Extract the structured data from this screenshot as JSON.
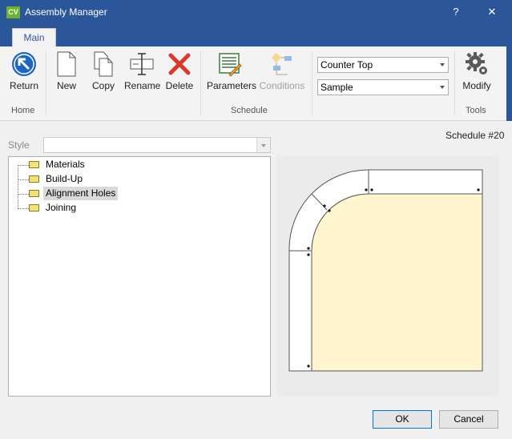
{
  "window": {
    "app_badge": "CV",
    "title": "Assembly Manager",
    "help": "?",
    "close": "✕"
  },
  "tabs": [
    {
      "label": "Main",
      "active": true
    }
  ],
  "ribbon": {
    "home": {
      "return_label": "Return",
      "group_label": "Home"
    },
    "schedule": {
      "new_label": "New",
      "copy_label": "Copy",
      "rename_label": "Rename",
      "delete_label": "Delete",
      "parameters_label": "Parameters",
      "conditions_label": "Conditions",
      "group_label": "Schedule",
      "combo_top": "Counter Top",
      "combo_bottom": "Sample"
    },
    "tools": {
      "modify_label": "Modify",
      "group_label": "Tools"
    }
  },
  "style": {
    "label": "Style",
    "value": ""
  },
  "schedule_number": "Schedule #20",
  "tree": {
    "items": [
      {
        "label": "Materials"
      },
      {
        "label": "Build-Up"
      },
      {
        "label": "Alignment Holes",
        "selected": true
      },
      {
        "label": "Joining"
      }
    ]
  },
  "buttons": {
    "ok": "OK",
    "cancel": "Cancel"
  },
  "colors": {
    "accent": "#2b579a",
    "app_badge": "#6ab42d",
    "delete_red": "#d9382c",
    "top_surface": "#fff5cf"
  },
  "icons": [
    "return-icon",
    "new-page-icon",
    "copy-icon",
    "rename-icon",
    "delete-icon",
    "parameters-icon",
    "conditions-icon",
    "gear-icon"
  ]
}
